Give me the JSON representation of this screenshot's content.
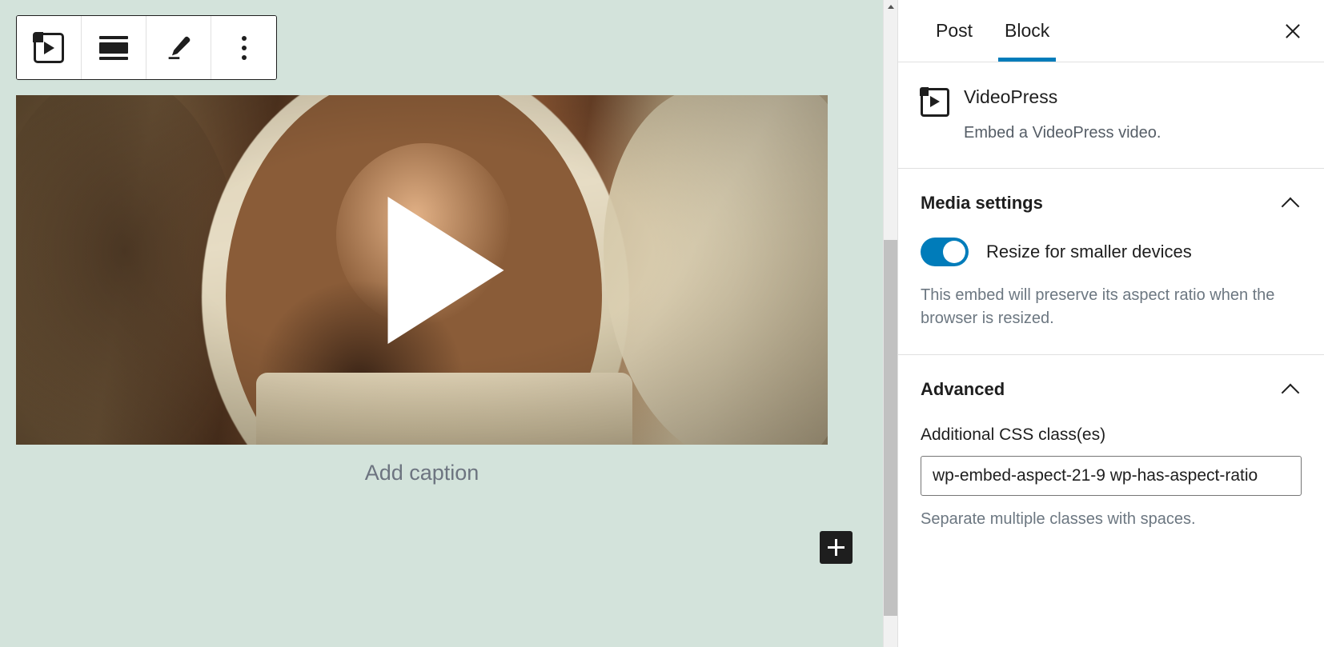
{
  "theme": {
    "canvas_bg": "#d3e3db",
    "accent": "#007cba",
    "toolbar_border": "#1e1e1e",
    "muted_text": "#6c7781",
    "caption_text": "#6d7480"
  },
  "toolbar": {
    "buttons": [
      {
        "name": "block-type-videopress",
        "icon": "videopress-icon",
        "label": "VideoPress"
      },
      {
        "name": "align",
        "icon": "align-icon",
        "label": "Change alignment"
      },
      {
        "name": "edit",
        "icon": "pencil-icon",
        "label": "Edit"
      },
      {
        "name": "more-options",
        "icon": "kebab-menu-icon",
        "label": "Options"
      }
    ]
  },
  "editor": {
    "video": {
      "alt": "Astronaut in a space helmet, warm sepia tones",
      "play_button_label": "Play"
    },
    "caption_placeholder": "Add caption",
    "add_block_label": "+"
  },
  "sidebar": {
    "tabs": [
      {
        "label": "Post",
        "active": false
      },
      {
        "label": "Block",
        "active": true
      }
    ],
    "close_label": "Close settings",
    "block_info": {
      "icon": "videopress-icon",
      "title": "VideoPress",
      "description": "Embed a VideoPress video."
    },
    "panels": [
      {
        "title": "Media settings",
        "expanded": true,
        "toggle": {
          "label": "Resize for smaller devices",
          "checked": true
        },
        "help": "This embed will preserve its aspect ratio when the browser is resized."
      },
      {
        "title": "Advanced",
        "expanded": true,
        "field_label": "Additional CSS class(es)",
        "field_value": "wp-embed-aspect-21-9 wp-has-aspect-ratio",
        "field_placeholder": "",
        "field_help": "Separate multiple classes with spaces."
      }
    ]
  }
}
